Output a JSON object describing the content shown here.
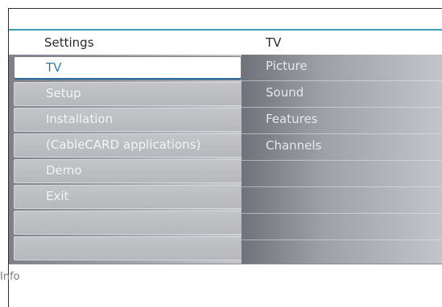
{
  "header": {
    "left_title": "Settings",
    "right_title": "TV"
  },
  "menu": {
    "items": [
      {
        "label": "TV"
      },
      {
        "label": "Setup"
      },
      {
        "label": "Installation"
      },
      {
        "label": "(CableCARD applications)"
      },
      {
        "label": "Demo"
      },
      {
        "label": "Exit"
      },
      {
        "label": ""
      },
      {
        "label": ""
      }
    ],
    "selected_label": "TV"
  },
  "submenu": {
    "items": [
      {
        "label": "Picture"
      },
      {
        "label": "Sound"
      },
      {
        "label": "Features"
      },
      {
        "label": "Channels"
      },
      {
        "label": ""
      },
      {
        "label": ""
      },
      {
        "label": ""
      },
      {
        "label": ""
      }
    ]
  },
  "footer": {
    "info_label": "Info"
  },
  "colors": {
    "accent": "#3aa0b8",
    "selected_text": "#2f7fa8"
  }
}
